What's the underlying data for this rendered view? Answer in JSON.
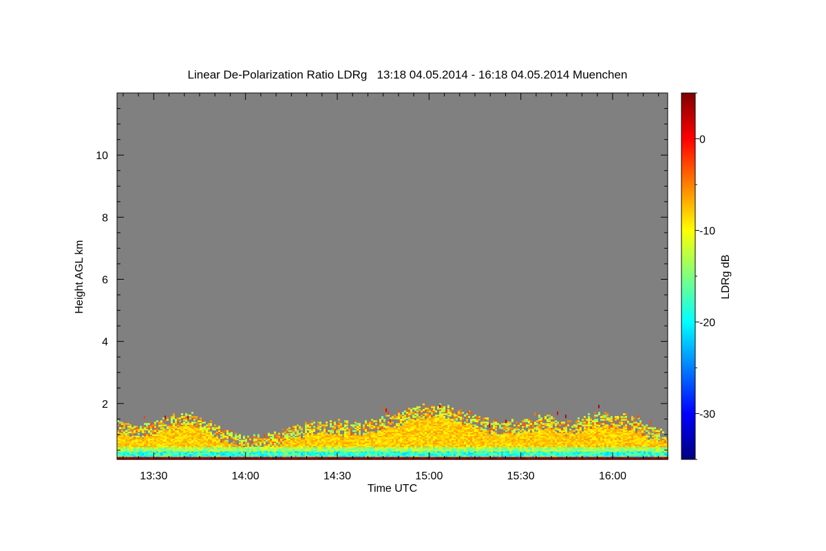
{
  "chart_data": {
    "type": "heatmap",
    "title": "Linear De-Polarization Ratio LDRg   13:18 04.05.2014 - 16:18 04.05.2014 Muenchen",
    "xlabel": "Time UTC",
    "ylabel": "Height AGL km",
    "colorbar_label": "LDRg dB",
    "x_range": [
      "13:18",
      "16:18"
    ],
    "y_range_km": [
      0.2,
      12.0
    ],
    "color_range_db": [
      -35,
      5
    ],
    "x_ticks": [
      "13:30",
      "14:00",
      "14:30",
      "15:00",
      "15:30",
      "16:00"
    ],
    "y_ticks": [
      "2",
      "4",
      "6",
      "8",
      "10"
    ],
    "colorbar_ticks": [
      "0",
      "-10",
      "-20",
      "-30"
    ],
    "background_color": "#808080",
    "colormap": [
      "#00007f",
      "#0000ff",
      "#007fff",
      "#00ffff",
      "#7fff7f",
      "#ffff00",
      "#ff7f00",
      "#ff0000",
      "#7f0000"
    ],
    "boundary_layer_top_km": [
      {
        "time": "13:18",
        "height": 1.1
      },
      {
        "time": "13:25",
        "height": 0.9
      },
      {
        "time": "13:35",
        "height": 1.2
      },
      {
        "time": "13:42",
        "height": 1.4
      },
      {
        "time": "13:50",
        "height": 0.9
      },
      {
        "time": "13:58",
        "height": 0.6
      },
      {
        "time": "14:05",
        "height": 0.55
      },
      {
        "time": "14:15",
        "height": 0.9
      },
      {
        "time": "14:25",
        "height": 1.1
      },
      {
        "time": "14:35",
        "height": 1.0
      },
      {
        "time": "14:45",
        "height": 1.2
      },
      {
        "time": "14:55",
        "height": 1.55
      },
      {
        "time": "15:05",
        "height": 1.6
      },
      {
        "time": "15:12",
        "height": 1.35
      },
      {
        "time": "15:20",
        "height": 1.05
      },
      {
        "time": "15:30",
        "height": 1.1
      },
      {
        "time": "15:38",
        "height": 1.25
      },
      {
        "time": "15:45",
        "height": 1.05
      },
      {
        "time": "15:55",
        "height": 1.3
      },
      {
        "time": "16:05",
        "height": 1.25
      },
      {
        "time": "16:12",
        "height": 0.9
      },
      {
        "time": "16:18",
        "height": 0.75
      }
    ]
  }
}
